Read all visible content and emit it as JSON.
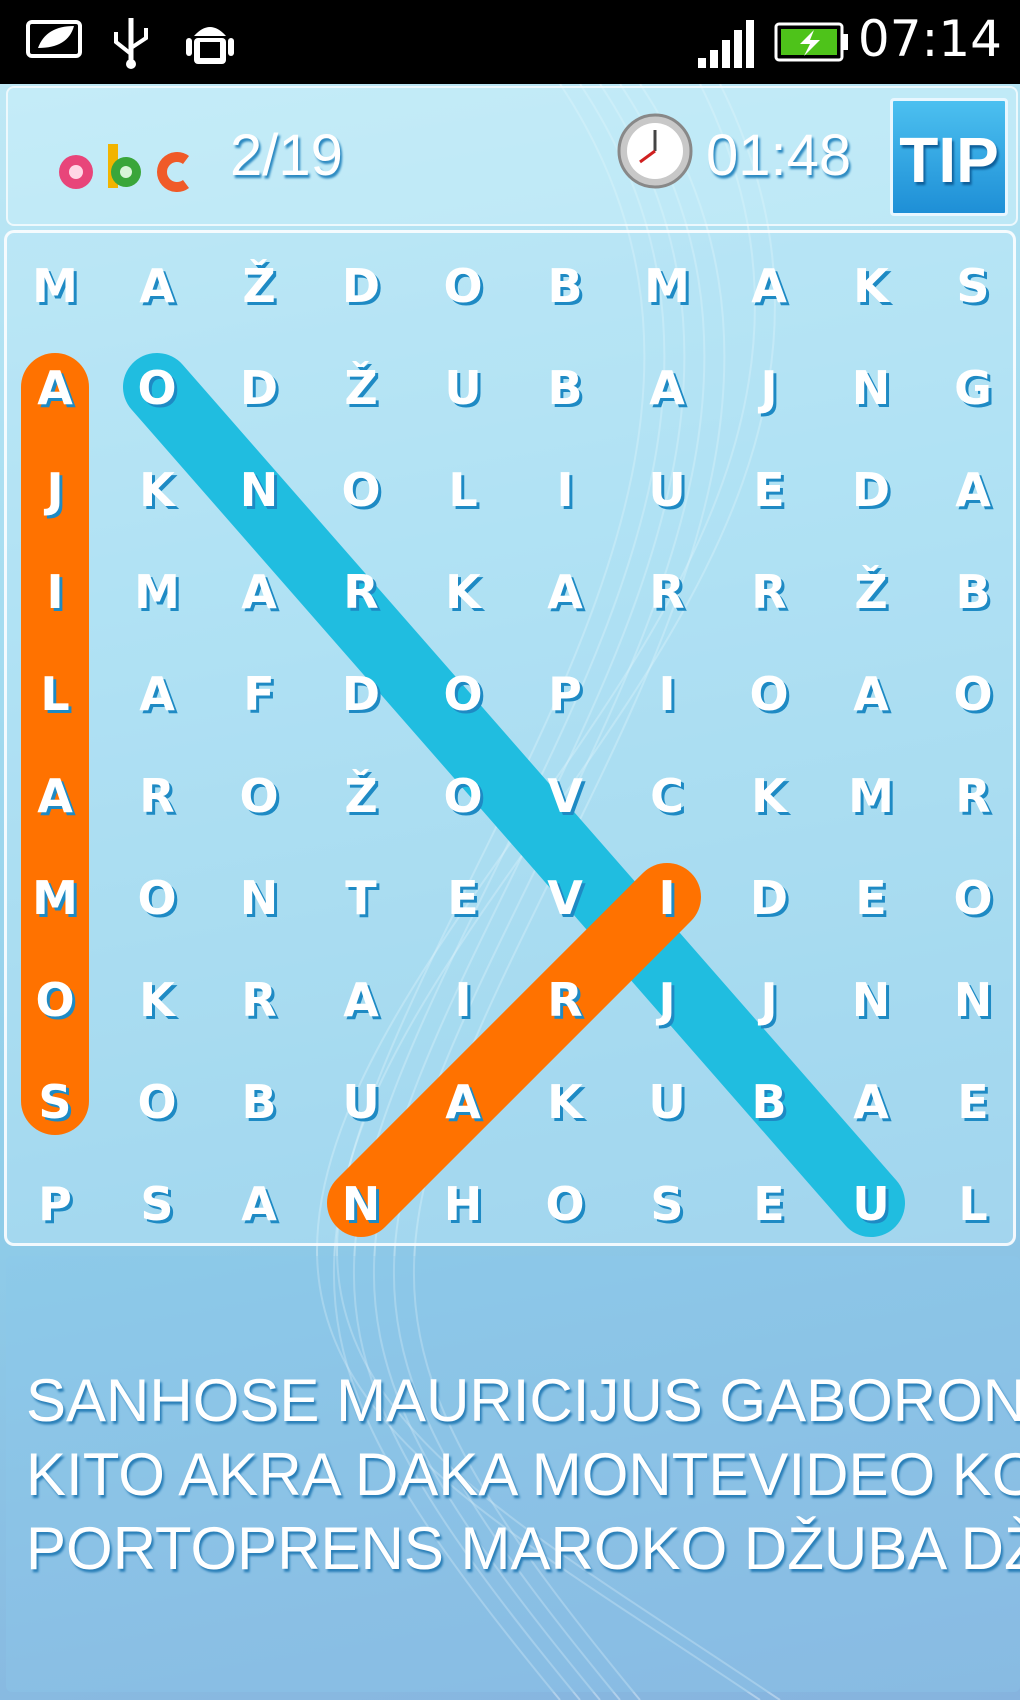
{
  "status_bar": {
    "time": "07:14",
    "icons": [
      "leaf-icon",
      "usb-icon",
      "android-debug-icon",
      "signal-icon",
      "battery-charging-icon"
    ]
  },
  "header": {
    "logo_text": "abc",
    "progress": "2/19",
    "timer": "01:48",
    "tip_label": "TIP"
  },
  "grid": {
    "rows": [
      [
        "M",
        "A",
        "Ž",
        "D",
        "O",
        "B",
        "M",
        "A",
        "K",
        "S"
      ],
      [
        "A",
        "O",
        "D",
        "Ž",
        "U",
        "B",
        "A",
        "J",
        "N",
        "G"
      ],
      [
        "J",
        "K",
        "N",
        "O",
        "L",
        "I",
        "U",
        "E",
        "D",
        "A"
      ],
      [
        "I",
        "M",
        "A",
        "R",
        "K",
        "A",
        "R",
        "R",
        "Ž",
        "B"
      ],
      [
        "L",
        "A",
        "F",
        "D",
        "O",
        "P",
        "I",
        "O",
        "A",
        "O"
      ],
      [
        "A",
        "R",
        "O",
        "Ž",
        "O",
        "V",
        "C",
        "K",
        "M",
        "R"
      ],
      [
        "M",
        "O",
        "N",
        "T",
        "E",
        "V",
        "I",
        "D",
        "E",
        "O"
      ],
      [
        "O",
        "K",
        "R",
        "A",
        "I",
        "R",
        "J",
        "J",
        "N",
        "N"
      ],
      [
        "S",
        "O",
        "B",
        "U",
        "A",
        "K",
        "U",
        "B",
        "A",
        "E"
      ],
      [
        "P",
        "S",
        "A",
        "N",
        "H",
        "O",
        "S",
        "E",
        "U",
        "L"
      ]
    ],
    "highlights": [
      {
        "color": "#ff7200",
        "from": [
          1,
          0
        ],
        "to": [
          8,
          0
        ]
      },
      {
        "color": "#20bde0",
        "from": [
          1,
          1
        ],
        "to": [
          9,
          8
        ]
      },
      {
        "color": "#ff7200",
        "from": [
          6,
          6
        ],
        "to": [
          9,
          3
        ]
      }
    ]
  },
  "word_list": [
    "SANHOSE MAURICIJUS GABORONE",
    "KITO AKRA DAKA MONTEVIDEO KO",
    "PORTOPRENS MAROKO DŽUBA DŽ"
  ]
}
